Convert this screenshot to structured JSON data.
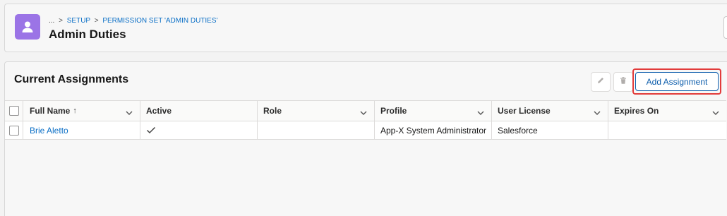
{
  "header": {
    "breadcrumb": {
      "ellipsis": "...",
      "separator": ">",
      "items": [
        "SETUP",
        "PERMISSION SET 'ADMIN DUTIES'"
      ]
    },
    "title": "Admin Duties",
    "icon": "user-icon",
    "icon_color": "#9b74e6"
  },
  "assignments": {
    "title": "Current Assignments",
    "actions": {
      "edit_icon": "pencil-icon",
      "delete_icon": "trash-icon",
      "add_label": "Add Assignment"
    },
    "columns": [
      {
        "label": "Full Name",
        "sorted": "ascending",
        "sort_indicator": "↑"
      },
      {
        "label": "Active"
      },
      {
        "label": "Role"
      },
      {
        "label": "Profile"
      },
      {
        "label": "User License"
      },
      {
        "label": "Expires On"
      }
    ],
    "rows": [
      {
        "full_name": "Brie Aletto",
        "active": "✓",
        "role": "",
        "profile": "App-X System Administrator",
        "user_license": "Salesforce",
        "expires_on": ""
      }
    ]
  },
  "colors": {
    "link": "#0b6fc6",
    "brand_button": "#0b5cab",
    "highlight_outline": "#e23b3b"
  }
}
